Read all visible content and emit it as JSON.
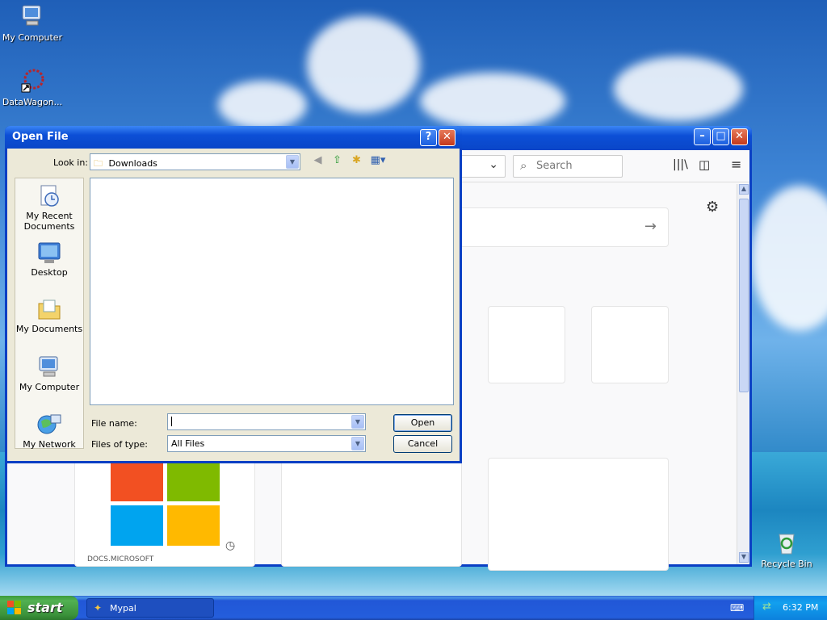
{
  "desktop": {
    "icons": [
      {
        "label": "My Computer"
      },
      {
        "label": "DataWagon..."
      },
      {
        "label": "Recycle Bin"
      }
    ]
  },
  "browser": {
    "search_placeholder": "Search",
    "tile_label": "DOCS.MICROSOFT"
  },
  "dialog": {
    "title": "Open File",
    "look_in_label": "Look in:",
    "look_in_value": "Downloads",
    "places": [
      {
        "label": "My Recent Documents"
      },
      {
        "label": "Desktop"
      },
      {
        "label": "My Documents"
      },
      {
        "label": "My Computer"
      },
      {
        "label": "My Network"
      }
    ],
    "file_name_label": "File name:",
    "file_name_value": "",
    "files_of_type_label": "Files of type:",
    "files_of_type_value": "All Files",
    "open_button": "Open",
    "cancel_button": "Cancel"
  },
  "taskbar": {
    "start_label": "start",
    "task_label": "Mypal",
    "clock": "6:32 PM"
  },
  "colors": {
    "title_blue": "#0a46c8",
    "dialog_face": "#ece9d8",
    "start_green": "#3a913a"
  }
}
